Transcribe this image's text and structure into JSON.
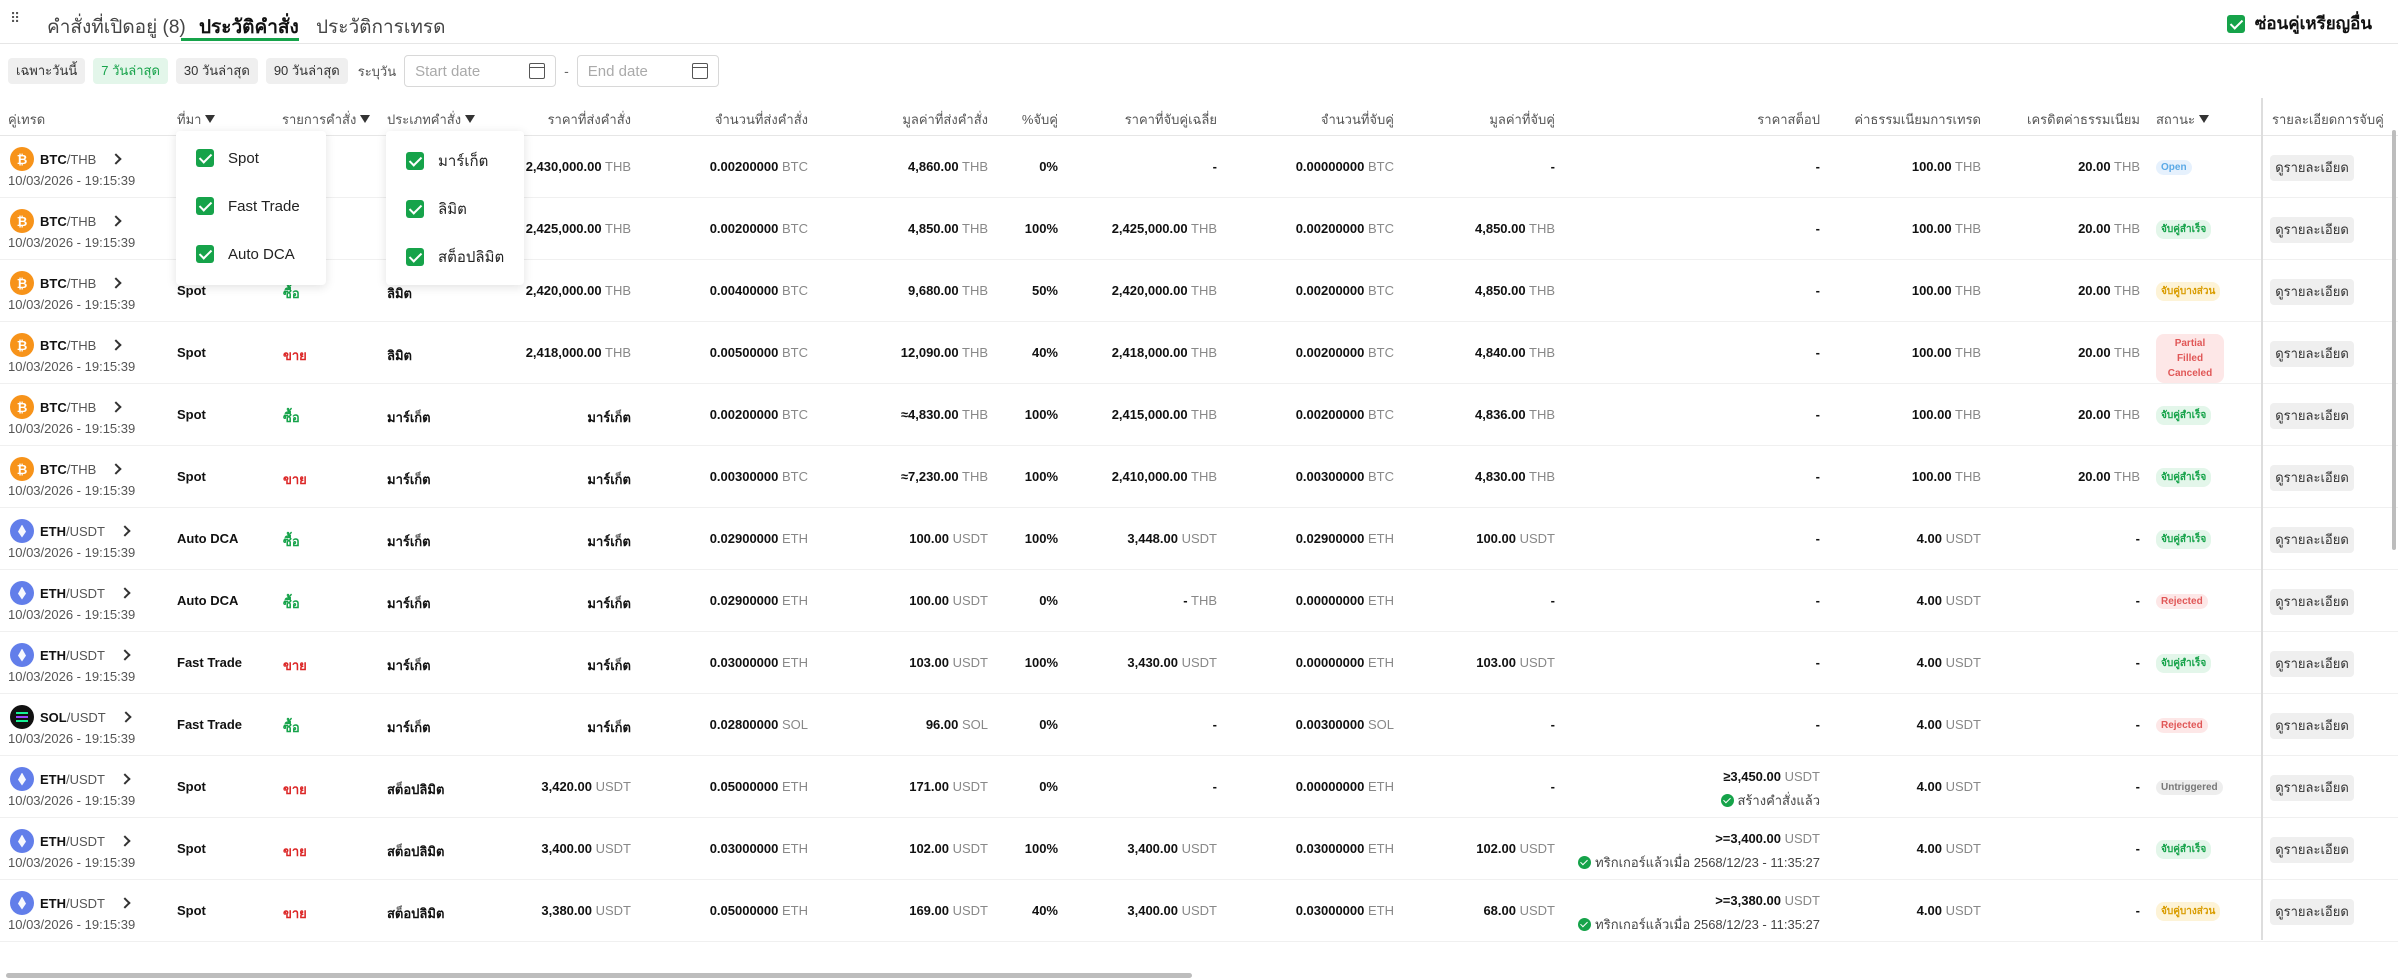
{
  "tabs": [
    {
      "label": "คำสั่งที่เปิดอยู่ (8)",
      "active": false
    },
    {
      "label": "ประวัติคำสั่ง",
      "active": true
    },
    {
      "label": "ประวัติการเทรด",
      "active": false
    }
  ],
  "hide_other": {
    "label": "ซ่อนคู่เหรียญอื่น",
    "checked": true
  },
  "filters": {
    "chips": [
      "เฉพาะวันนี้",
      "7 วันล่าสุด",
      "30 วันล่าสุด",
      "90 วันล่าสุด"
    ],
    "active_chip": "7 วันล่าสุด",
    "range_label": "ระบุวัน",
    "start_placeholder": "Start date",
    "end_placeholder": "End date",
    "separator": "-"
  },
  "columns": {
    "pair": "คู่เทรด",
    "source": "ที่มา",
    "side": "รายการคำสั่ง",
    "order_type": "ประเภทคำสั่ง",
    "order_price": "ราคาที่ส่งคำสั่ง",
    "order_amount": "จำนวนที่ส่งคำสั่ง",
    "order_value": "มูลค่าที่ส่งคำสั่ง",
    "pct_matched": "%จับคู่",
    "avg_price": "ราคาที่จับคู่เฉลี่ย",
    "matched_amount": "จำนวนที่จับคู่",
    "matched_value": "มูลค่าที่จับคู่",
    "stop_price": "ราคาสต็อป",
    "fee": "ค่าธรรมเนียมการเทรด",
    "fee_credit": "เครดิตค่าธรรมเนียม",
    "status": "สถานะ",
    "details": "รายละเอียดการจับคู่"
  },
  "source_dropdown": {
    "options": [
      {
        "label": "Spot",
        "checked": true
      },
      {
        "label": "Fast Trade",
        "checked": true
      },
      {
        "label": "Auto DCA",
        "checked": true
      }
    ]
  },
  "type_dropdown": {
    "options": [
      {
        "label": "มาร์เก็ต",
        "checked": true
      },
      {
        "label": "ลิมิต",
        "checked": true
      },
      {
        "label": "สต็อปลิมิต",
        "checked": true
      }
    ]
  },
  "detail_label": "ดูรายละเอียด",
  "rows": [
    {
      "base": "BTC",
      "quote": "/THB",
      "coin": "btc",
      "date": "10/03/2026 - 19:15:39",
      "source": "",
      "side": "",
      "side_class": "buy",
      "type": "",
      "price": "2,430,000.00",
      "price_unit": "THB",
      "amount": "0.00200000",
      "amount_unit": "BTC",
      "value": "4,860.00",
      "value_unit": "THB",
      "pct": "0%",
      "avg": "-",
      "avg_unit": "",
      "matched": "0.00000000",
      "matched_unit": "BTC",
      "mvalue": "-",
      "mvalue_unit": "",
      "stop": "-",
      "stop_unit": "",
      "stop_note": "",
      "fee": "100.00",
      "fee_unit": "THB",
      "credit": "20.00",
      "credit_unit": "THB",
      "status": "Open",
      "status_class": "b-open"
    },
    {
      "base": "BTC",
      "quote": "/THB",
      "coin": "btc",
      "date": "10/03/2026 - 19:15:39",
      "source": "",
      "side": "",
      "side_class": "buy",
      "type": "",
      "price": "2,425,000.00",
      "price_unit": "THB",
      "amount": "0.00200000",
      "amount_unit": "BTC",
      "value": "4,850.00",
      "value_unit": "THB",
      "pct": "100%",
      "avg": "2,425,000.00",
      "avg_unit": "THB",
      "matched": "0.00200000",
      "matched_unit": "BTC",
      "mvalue": "4,850.00",
      "mvalue_unit": "THB",
      "stop": "-",
      "stop_unit": "",
      "stop_note": "",
      "fee": "100.00",
      "fee_unit": "THB",
      "credit": "20.00",
      "credit_unit": "THB",
      "status": "จับคู่สำเร็จ",
      "status_class": "b-ok"
    },
    {
      "base": "BTC",
      "quote": "/THB",
      "coin": "btc",
      "date": "10/03/2026 - 19:15:39",
      "source": "Spot",
      "side": "ซื้อ",
      "side_class": "buy",
      "type": "ลิมิต",
      "price": "2,420,000.00",
      "price_unit": "THB",
      "amount": "0.00400000",
      "amount_unit": "BTC",
      "value": "9,680.00",
      "value_unit": "THB",
      "pct": "50%",
      "avg": "2,420,000.00",
      "avg_unit": "THB",
      "matched": "0.00200000",
      "matched_unit": "BTC",
      "mvalue": "4,850.00",
      "mvalue_unit": "THB",
      "stop": "-",
      "stop_unit": "",
      "stop_note": "",
      "fee": "100.00",
      "fee_unit": "THB",
      "credit": "20.00",
      "credit_unit": "THB",
      "status": "จับคู่บางส่วน",
      "status_class": "b-part"
    },
    {
      "base": "BTC",
      "quote": "/THB",
      "coin": "btc",
      "date": "10/03/2026 - 19:15:39",
      "source": "Spot",
      "side": "ขาย",
      "side_class": "sell",
      "type": "ลิมิต",
      "price": "2,418,000.00",
      "price_unit": "THB",
      "amount": "0.00500000",
      "amount_unit": "BTC",
      "value": "12,090.00",
      "value_unit": "THB",
      "pct": "40%",
      "avg": "2,418,000.00",
      "avg_unit": "THB",
      "matched": "0.00200000",
      "matched_unit": "BTC",
      "mvalue": "4,840.00",
      "mvalue_unit": "THB",
      "stop": "-",
      "stop_unit": "",
      "stop_note": "",
      "fee": "100.00",
      "fee_unit": "THB",
      "credit": "20.00",
      "credit_unit": "THB",
      "status": "Partial Filled Canceled",
      "status_class": "b-pfc"
    },
    {
      "base": "BTC",
      "quote": "/THB",
      "coin": "btc",
      "date": "10/03/2026 - 19:15:39",
      "source": "Spot",
      "side": "ซื้อ",
      "side_class": "buy",
      "type": "มาร์เก็ต",
      "price": "มาร์เก็ต",
      "price_unit": "",
      "amount": "0.00200000",
      "amount_unit": "BTC",
      "value": "≈4,830.00",
      "value_unit": "THB",
      "pct": "100%",
      "avg": "2,415,000.00",
      "avg_unit": "THB",
      "matched": "0.00200000",
      "matched_unit": "BTC",
      "mvalue": "4,836.00",
      "mvalue_unit": "THB",
      "stop": "-",
      "stop_unit": "",
      "stop_note": "",
      "fee": "100.00",
      "fee_unit": "THB",
      "credit": "20.00",
      "credit_unit": "THB",
      "status": "จับคู่สำเร็จ",
      "status_class": "b-ok"
    },
    {
      "base": "BTC",
      "quote": "/THB",
      "coin": "btc",
      "date": "10/03/2026 - 19:15:39",
      "source": "Spot",
      "side": "ขาย",
      "side_class": "sell",
      "type": "มาร์เก็ต",
      "price": "มาร์เก็ต",
      "price_unit": "",
      "amount": "0.00300000",
      "amount_unit": "BTC",
      "value": "≈7,230.00",
      "value_unit": "THB",
      "pct": "100%",
      "avg": "2,410,000.00",
      "avg_unit": "THB",
      "matched": "0.00300000",
      "matched_unit": "BTC",
      "mvalue": "4,830.00",
      "mvalue_unit": "THB",
      "stop": "-",
      "stop_unit": "",
      "stop_note": "",
      "fee": "100.00",
      "fee_unit": "THB",
      "credit": "20.00",
      "credit_unit": "THB",
      "status": "จับคู่สำเร็จ",
      "status_class": "b-ok"
    },
    {
      "base": "ETH",
      "quote": "/USDT",
      "coin": "eth",
      "date": "10/03/2026 - 19:15:39",
      "source": "Auto DCA",
      "side": "ซื้อ",
      "side_class": "buy",
      "type": "มาร์เก็ต",
      "price": "มาร์เก็ต",
      "price_unit": "",
      "amount": "0.02900000",
      "amount_unit": "ETH",
      "value": "100.00",
      "value_unit": "USDT",
      "pct": "100%",
      "avg": "3,448.00",
      "avg_unit": "USDT",
      "matched": "0.02900000",
      "matched_unit": "ETH",
      "mvalue": "100.00",
      "mvalue_unit": "USDT",
      "stop": "-",
      "stop_unit": "",
      "stop_note": "",
      "fee": "4.00",
      "fee_unit": "USDT",
      "credit": "-",
      "credit_unit": "",
      "status": "จับคู่สำเร็จ",
      "status_class": "b-ok"
    },
    {
      "base": "ETH",
      "quote": "/USDT",
      "coin": "eth",
      "date": "10/03/2026 - 19:15:39",
      "source": "Auto DCA",
      "side": "ซื้อ",
      "side_class": "buy",
      "type": "มาร์เก็ต",
      "price": "มาร์เก็ต",
      "price_unit": "",
      "amount": "0.02900000",
      "amount_unit": "ETH",
      "value": "100.00",
      "value_unit": "USDT",
      "pct": "0%",
      "avg": "-",
      "avg_unit": "THB",
      "matched": "0.00000000",
      "matched_unit": "ETH",
      "mvalue": "-",
      "mvalue_unit": "",
      "stop": "-",
      "stop_unit": "",
      "stop_note": "",
      "fee": "4.00",
      "fee_unit": "USDT",
      "credit": "-",
      "credit_unit": "",
      "status": "Rejected",
      "status_class": "b-rej"
    },
    {
      "base": "ETH",
      "quote": "/USDT",
      "coin": "eth",
      "date": "10/03/2026 - 19:15:39",
      "source": "Fast Trade",
      "side": "ขาย",
      "side_class": "sell",
      "type": "มาร์เก็ต",
      "price": "มาร์เก็ต",
      "price_unit": "",
      "amount": "0.03000000",
      "amount_unit": "ETH",
      "value": "103.00",
      "value_unit": "USDT",
      "pct": "100%",
      "avg": "3,430.00",
      "avg_unit": "USDT",
      "matched": "0.00000000",
      "matched_unit": "ETH",
      "mvalue": "103.00",
      "mvalue_unit": "USDT",
      "stop": "-",
      "stop_unit": "",
      "stop_note": "",
      "fee": "4.00",
      "fee_unit": "USDT",
      "credit": "-",
      "credit_unit": "",
      "status": "จับคู่สำเร็จ",
      "status_class": "b-ok"
    },
    {
      "base": "SOL",
      "quote": "/USDT",
      "coin": "sol",
      "date": "10/03/2026 - 19:15:39",
      "source": "Fast Trade",
      "side": "ซื้อ",
      "side_class": "buy",
      "type": "มาร์เก็ต",
      "price": "มาร์เก็ต",
      "price_unit": "",
      "amount": "0.02800000",
      "amount_unit": "SOL",
      "value": "96.00",
      "value_unit": "SOL",
      "pct": "0%",
      "avg": "-",
      "avg_unit": "",
      "matched": "0.00300000",
      "matched_unit": "SOL",
      "mvalue": "-",
      "mvalue_unit": "",
      "stop": "-",
      "stop_unit": "",
      "stop_note": "",
      "fee": "4.00",
      "fee_unit": "USDT",
      "credit": "-",
      "credit_unit": "",
      "status": "Rejected",
      "status_class": "b-rej"
    },
    {
      "base": "ETH",
      "quote": "/USDT",
      "coin": "eth",
      "date": "10/03/2026 - 19:15:39",
      "source": "Spot",
      "side": "ขาย",
      "side_class": "sell",
      "type": "สต็อปลิมิต",
      "price": "3,420.00",
      "price_unit": "USDT",
      "amount": "0.05000000",
      "amount_unit": "ETH",
      "value": "171.00",
      "value_unit": "USDT",
      "pct": "0%",
      "avg": "-",
      "avg_unit": "",
      "matched": "0.00000000",
      "matched_unit": "ETH",
      "mvalue": "-",
      "mvalue_unit": "",
      "stop": "≥3,450.00",
      "stop_unit": "USDT",
      "stop_note": "สร้างคำสั่งแล้ว",
      "fee": "4.00",
      "fee_unit": "USDT",
      "credit": "-",
      "credit_unit": "",
      "status": "Untriggered",
      "status_class": "b-untr"
    },
    {
      "base": "ETH",
      "quote": "/USDT",
      "coin": "eth",
      "date": "10/03/2026 - 19:15:39",
      "source": "Spot",
      "side": "ขาย",
      "side_class": "sell",
      "type": "สต็อปลิมิต",
      "price": "3,400.00",
      "price_unit": "USDT",
      "amount": "0.03000000",
      "amount_unit": "ETH",
      "value": "102.00",
      "value_unit": "USDT",
      "pct": "100%",
      "avg": "3,400.00",
      "avg_unit": "USDT",
      "matched": "0.03000000",
      "matched_unit": "ETH",
      "mvalue": "102.00",
      "mvalue_unit": "USDT",
      "stop": ">=3,400.00",
      "stop_unit": "USDT",
      "stop_note": "ทริกเกอร์แล้วเมื่อ 2568/12/23 - 11:35:27",
      "fee": "4.00",
      "fee_unit": "USDT",
      "credit": "-",
      "credit_unit": "",
      "status": "จับคู่สำเร็จ",
      "status_class": "b-ok"
    },
    {
      "base": "ETH",
      "quote": "/USDT",
      "coin": "eth",
      "date": "10/03/2026 - 19:15:39",
      "source": "Spot",
      "side": "ขาย",
      "side_class": "sell",
      "type": "สต็อปลิมิต",
      "price": "3,380.00",
      "price_unit": "USDT",
      "amount": "0.05000000",
      "amount_unit": "ETH",
      "value": "169.00",
      "value_unit": "USDT",
      "pct": "40%",
      "avg": "3,400.00",
      "avg_unit": "USDT",
      "matched": "0.03000000",
      "matched_unit": "ETH",
      "mvalue": "68.00",
      "mvalue_unit": "USDT",
      "stop": ">=3,380.00",
      "stop_unit": "USDT",
      "stop_note": "ทริกเกอร์แล้วเมื่อ 2568/12/23 - 11:35:27",
      "fee": "4.00",
      "fee_unit": "USDT",
      "credit": "-",
      "credit_unit": "",
      "status": "จับคู่บางส่วน",
      "status_class": "b-part"
    }
  ]
}
